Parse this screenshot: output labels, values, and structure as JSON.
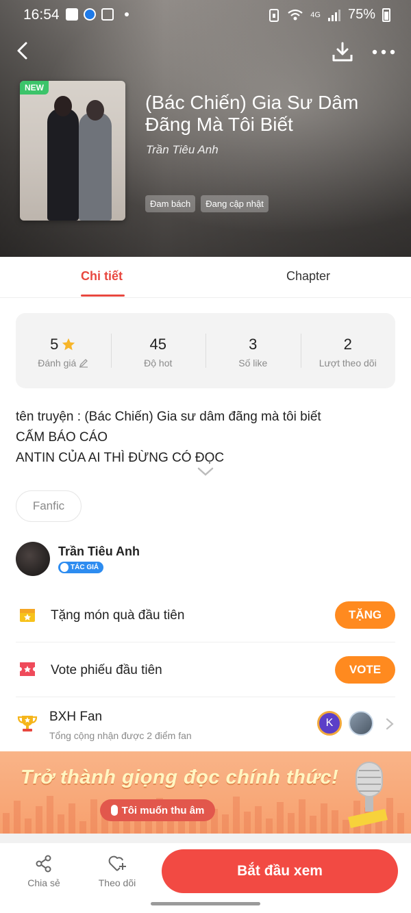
{
  "status_bar": {
    "time": "16:54",
    "battery": "75%",
    "network": "4G"
  },
  "header": {
    "icons": [
      "back-arrow-icon",
      "download-icon",
      "more-icon"
    ]
  },
  "book": {
    "badge": "NEW",
    "title": "(Bác Chiến) Gia Sư Dâm Đãng Mà Tôi Biết",
    "author": "Trần Tiêu Anh",
    "tags": [
      "Đam bách",
      "Đang cập nhật"
    ]
  },
  "tabs": [
    {
      "label": "Chi tiết",
      "active": true
    },
    {
      "label": "Chapter",
      "active": false
    }
  ],
  "stats": [
    {
      "value": "5",
      "label": "Đánh giá"
    },
    {
      "value": "45",
      "label": "Độ hot"
    },
    {
      "value": "3",
      "label": "Số like"
    },
    {
      "value": "2",
      "label": "Lượt theo dõi"
    }
  ],
  "description": [
    "tên truyện : (Bác Chiến) Gia sư dâm đãng mà tôi biết",
    "CẤM BÁO CÁO",
    "ANTIN CỦA AI THÌ ĐỪNG CÓ ĐỌC"
  ],
  "genre": "Fanfic",
  "author_card": {
    "name": "Trần Tiêu Anh",
    "badge": "TÁC GIẢ"
  },
  "gift_row": {
    "label": "Tặng món quà đầu tiên",
    "button": "TẶNG"
  },
  "vote_row": {
    "label": "Vote phiếu đầu tiên",
    "button": "VOTE"
  },
  "fan_row": {
    "title": "BXH Fan",
    "subtitle": "Tổng cộng nhận được 2 điểm fan",
    "avatar_initial": "K"
  },
  "banner": {
    "title": "Trở thành giọng đọc chính thức!",
    "button": "Tôi muốn thu âm"
  },
  "bottom_bar": {
    "share": "Chia sẻ",
    "follow": "Theo dõi",
    "start": "Bắt đầu xem"
  },
  "colors": {
    "accent_red": "#e8473f",
    "orange": "#ff8a1f",
    "start_button": "#f24a43",
    "author_badge": "#2d8cf0",
    "new_badge": "#3cc46a"
  }
}
